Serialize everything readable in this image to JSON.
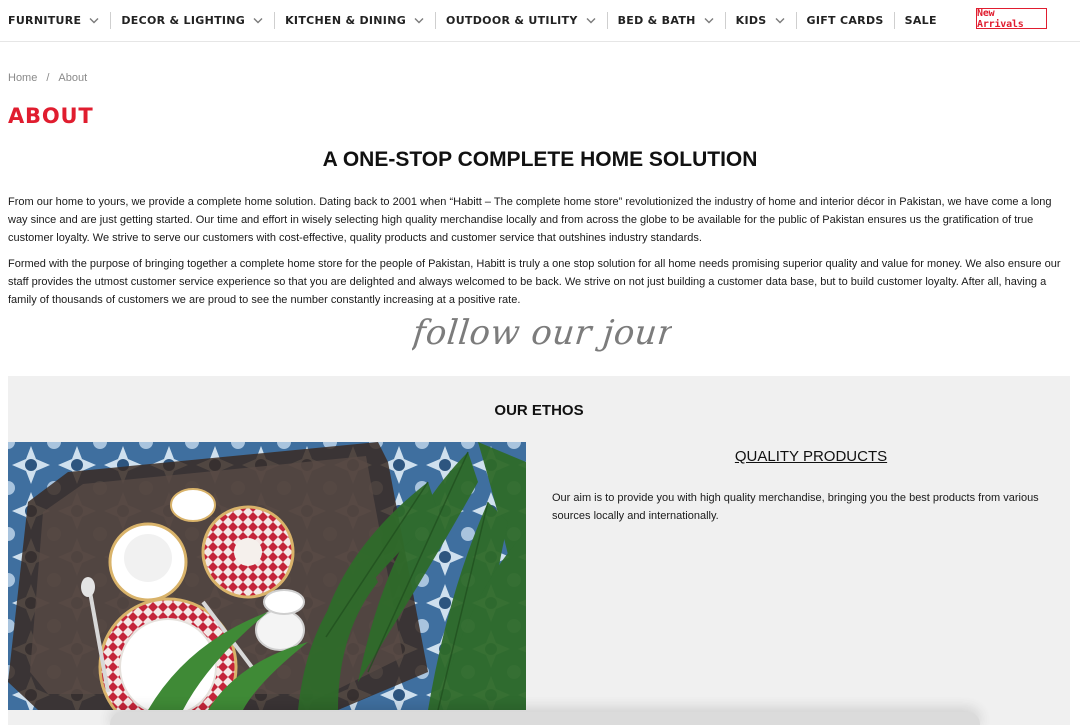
{
  "nav": {
    "items": [
      {
        "label": "FURNITURE",
        "has_dropdown": true
      },
      {
        "label": "DECOR & LIGHTING",
        "has_dropdown": true
      },
      {
        "label": "KITCHEN & DINING",
        "has_dropdown": true
      },
      {
        "label": "OUTDOOR & UTILITY",
        "has_dropdown": true
      },
      {
        "label": "BED & BATH",
        "has_dropdown": true
      },
      {
        "label": "KIDS",
        "has_dropdown": true
      },
      {
        "label": "GIFT CARDS",
        "has_dropdown": false
      },
      {
        "label": "SALE",
        "has_dropdown": false
      }
    ],
    "new_arrivals": "New Arrivals",
    "chevron_icon": "chevron-down-icon"
  },
  "breadcrumb": {
    "home": "Home",
    "separator": "/",
    "current": "About"
  },
  "page": {
    "title": "ABOUT",
    "headline": "A ONE-STOP COMPLETE HOME SOLUTION",
    "paragraph1": "From our home to yours, we provide a complete home solution. Dating back to 2001 when “Habitt – The complete home store” revolutionized the industry of home and interior décor in Pakistan, we have come a long way since and are just getting started. Our time and effort in wisely selecting high quality merchandise locally and from across the globe to be available for the public of Pakistan ensures us the gratification of true customer loyalty. We strive to serve our customers with cost-effective, quality products and customer service that outshines industry standards.",
    "paragraph2": "Formed with the purpose of bringing together a complete home store for the people of Pakistan, Habitt is truly a one stop solution for all home needs promising superior quality and value for money. We also ensure our staff provides the utmost customer service experience so that you are delighted and always welcomed to be back. We strive on not just building a customer data base, but to build customer loyalty. After all, having a family of thousands of customers we are proud to see the number constantly increasing at a positive rate.",
    "journey_script": "follow our journey"
  },
  "ethos": {
    "title": "OUR ETHOS",
    "feature_title": "QUALITY PRODUCTS",
    "feature_text": "Our aim is to provide you with high quality merchandise, bringing you the best products from various sources locally and internationally."
  },
  "colors": {
    "accent": "#e01d2f",
    "section_bg": "#f0f0f0",
    "text": "#111111"
  }
}
